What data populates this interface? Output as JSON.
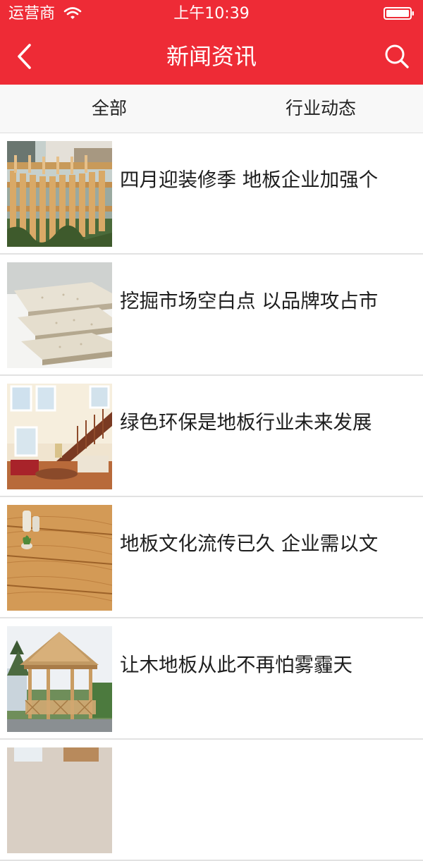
{
  "status_bar": {
    "carrier": "运营商",
    "time": "上午10:39"
  },
  "header": {
    "title": "新闻资讯"
  },
  "tabs": [
    {
      "label": "全部"
    },
    {
      "label": "行业动态"
    }
  ],
  "articles": [
    {
      "title": "四月迎装修季 地板企业加强个"
    },
    {
      "title": "挖掘市场空白点 以品牌攻占市"
    },
    {
      "title": "绿色环保是地板行业未来发展"
    },
    {
      "title": "地板文化流传已久 企业需以文"
    },
    {
      "title": "让木地板从此不再怕雾霾天"
    }
  ],
  "colors": {
    "brand": "#ee2b36"
  }
}
